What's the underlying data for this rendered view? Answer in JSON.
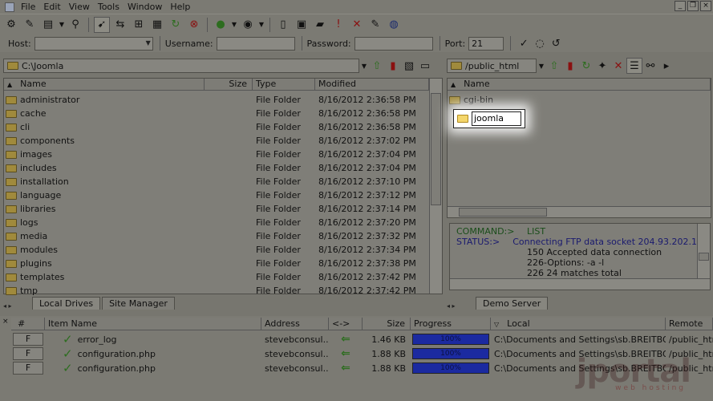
{
  "menu": [
    "File",
    "Edit",
    "View",
    "Tools",
    "Window",
    "Help"
  ],
  "window_buttons": [
    "_",
    "❐",
    "×"
  ],
  "connection": {
    "host_label": "Host:",
    "host_value": "",
    "username_label": "Username:",
    "username_value": "",
    "password_label": "Password:",
    "password_value": "",
    "port_label": "Port:",
    "port_value": "21"
  },
  "local": {
    "path": "C:\\Joomla",
    "columns": {
      "name": "Name",
      "size": "Size",
      "type": "Type",
      "modified": "Modified"
    },
    "rows": [
      {
        "name": "administrator",
        "type": "File Folder",
        "modified": "8/16/2012 2:36:58 PM"
      },
      {
        "name": "cache",
        "type": "File Folder",
        "modified": "8/16/2012 2:36:58 PM"
      },
      {
        "name": "cli",
        "type": "File Folder",
        "modified": "8/16/2012 2:36:58 PM"
      },
      {
        "name": "components",
        "type": "File Folder",
        "modified": "8/16/2012 2:37:02 PM"
      },
      {
        "name": "images",
        "type": "File Folder",
        "modified": "8/16/2012 2:37:04 PM"
      },
      {
        "name": "includes",
        "type": "File Folder",
        "modified": "8/16/2012 2:37:04 PM"
      },
      {
        "name": "installation",
        "type": "File Folder",
        "modified": "8/16/2012 2:37:10 PM"
      },
      {
        "name": "language",
        "type": "File Folder",
        "modified": "8/16/2012 2:37:12 PM"
      },
      {
        "name": "libraries",
        "type": "File Folder",
        "modified": "8/16/2012 2:37:14 PM"
      },
      {
        "name": "logs",
        "type": "File Folder",
        "modified": "8/16/2012 2:37:20 PM"
      },
      {
        "name": "media",
        "type": "File Folder",
        "modified": "8/16/2012 2:37:32 PM"
      },
      {
        "name": "modules",
        "type": "File Folder",
        "modified": "8/16/2012 2:37:34 PM"
      },
      {
        "name": "plugins",
        "type": "File Folder",
        "modified": "8/16/2012 2:37:38 PM"
      },
      {
        "name": "templates",
        "type": "File Folder",
        "modified": "8/16/2012 2:37:42 PM"
      },
      {
        "name": "tmp",
        "type": "File Folder",
        "modified": "8/16/2012 2:37:42 PM"
      }
    ],
    "tabs": [
      "Local Drives",
      "Site Manager"
    ]
  },
  "remote": {
    "path": "/public_html",
    "columns": {
      "name": "Name"
    },
    "rows": [
      {
        "name": "cgi-bin"
      }
    ],
    "rename_value": "joomla",
    "tabs": [
      "Demo Server"
    ]
  },
  "log": [
    {
      "key": "COMMAND:>",
      "value": "LIST",
      "kind": "cmd"
    },
    {
      "key": "STATUS:>",
      "value": "Connecting FTP data socket 204.93.202.1",
      "kind": "sts"
    },
    {
      "key": "",
      "value": "150 Accepted data connection",
      "kind": ""
    },
    {
      "key": "",
      "value": "226-Options: -a -l",
      "kind": ""
    },
    {
      "key": "",
      "value": "226 24 matches total",
      "kind": ""
    }
  ],
  "queue": {
    "columns": {
      "num": "#",
      "item": "Item Name",
      "address": "Address",
      "dir": "<->",
      "size": "Size",
      "progress": "Progress",
      "local": "Local",
      "remote": "Remote"
    },
    "rows": [
      {
        "btn": "F",
        "item": "error_log",
        "address": "stevebconsul...",
        "size": "1.46 KB",
        "progress": "100%",
        "local": "C:\\Documents and Settings\\sb.BREITBO...",
        "remote": "/public_htr"
      },
      {
        "btn": "F",
        "item": "configuration.php",
        "address": "stevebconsul...",
        "size": "1.88 KB",
        "progress": "100%",
        "local": "C:\\Documents and Settings\\sb.BREITBO...",
        "remote": "/public_htr"
      },
      {
        "btn": "F",
        "item": "configuration.php",
        "address": "stevebconsul...",
        "size": "1.88 KB",
        "progress": "100%",
        "local": "C:\\Documents and Settings\\sb.BREITBO...",
        "remote": "/public_htr"
      }
    ]
  },
  "watermark": {
    "brand": "jportal",
    "sub": "web hosting"
  },
  "colors": {
    "progress": "#1b2aa0",
    "check": "#2d6d1f",
    "highlight": "#ffffff"
  }
}
